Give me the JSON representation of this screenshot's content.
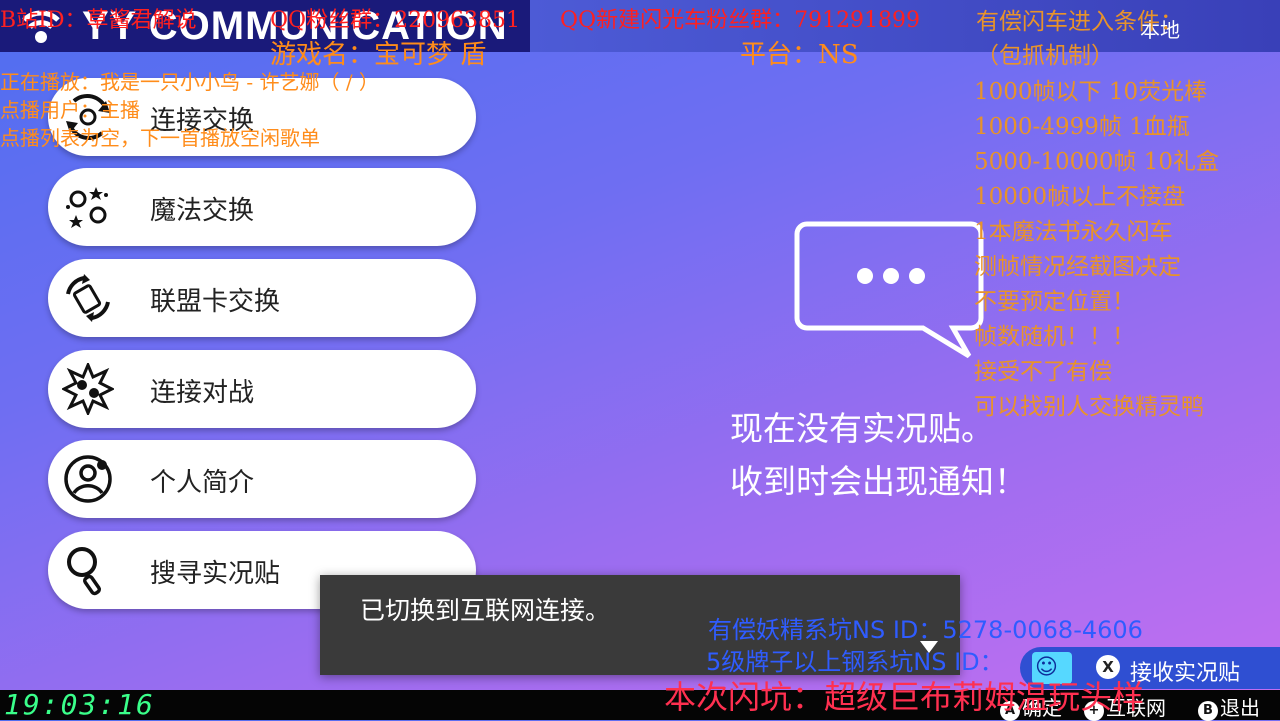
{
  "header": {
    "title": "YY COMMUNICATION",
    "local_label": "本地"
  },
  "menu": {
    "items": [
      {
        "label": "连接交换",
        "icon": "link-trade-icon"
      },
      {
        "label": "魔法交换",
        "icon": "surprise-trade-icon"
      },
      {
        "label": "联盟卡交换",
        "icon": "league-card-trade-icon"
      },
      {
        "label": "连接对战",
        "icon": "battle-icon"
      },
      {
        "label": "个人简介",
        "icon": "profile-icon"
      },
      {
        "label": "搜寻实况贴",
        "icon": "search-icon"
      }
    ]
  },
  "main": {
    "empty_line1": "现在没有实况贴。",
    "empty_line2": "收到时会出现通知！"
  },
  "toast": {
    "text": "已切换到互联网连接。"
  },
  "notification": {
    "label": "接收实况贴",
    "button": "X"
  },
  "footer": {
    "hints": [
      {
        "button": "A",
        "label": "确定"
      },
      {
        "button": "+",
        "label": "互联网"
      },
      {
        "button": "B",
        "label": "退出"
      }
    ]
  },
  "stream_overlay": {
    "bilibili_id": "B站ID：草酱君解说",
    "qq_group": "QQ粉丝群：220963851",
    "qq_new_group": "QQ新建闪光车粉丝群：791291899",
    "game_name": "游戏名：宝可梦 盾",
    "platform": "平台：NS",
    "now_playing": "正在播放：我是一只小小鸟 - 许艺娜（ / ）",
    "requested_by": "点播用户：主播",
    "queue_empty": "点播列表为空，下一首播放空闲歌单",
    "rules": [
      "有偿闪车进入条件：",
      "（包抓机制）",
      "1000帧以下 10荧光棒",
      "1000-4999帧 1血瓶",
      "5000-10000帧 10礼盒",
      "10000帧以上不接盘",
      "1本魔法书永久闪车",
      "测帧情况经截图决定",
      "不要预定位置！",
      "帧数随机！！！",
      "接受不了有偿",
      "可以找别人交换精灵鸭"
    ],
    "paid_fairy": "有偿妖精系坑NS ID：5278-0068-4606",
    "steel_line": "5级牌子以上钢系坑NS ID：",
    "bottom_banner": "本次闪坑：超级巨布莉姆温玩头样",
    "clock": "19:03:16"
  },
  "colors": {
    "header_bg": "#1a1a7a",
    "toast_bg": "#3a3a3a",
    "notification_bg": "#2f4fd2",
    "clock": "#3aff8a"
  }
}
